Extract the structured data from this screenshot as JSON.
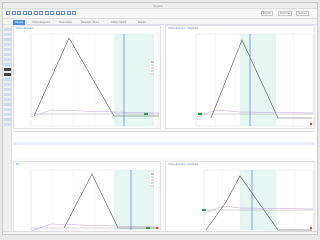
{
  "window": {
    "title": "Skyline"
  },
  "toolbar": {
    "buttons": [
      "new-icon",
      "open-icon",
      "save-icon",
      "undo-icon",
      "redo-icon",
      "cut-icon",
      "copy-icon",
      "paste-icon",
      "zoom-in-icon",
      "zoom-out-icon",
      "select-icon",
      "chart-icon",
      "table-icon"
    ],
    "right_fields": [
      "Peptide",
      "Replicate",
      "Settings"
    ]
  },
  "tabs": [
    {
      "label": "Targets",
      "active": true
    },
    {
      "label": "Chromatograms",
      "active": false
    },
    {
      "label": "Peak Areas",
      "active": false
    },
    {
      "label": "Retention Times",
      "active": false
    },
    {
      "label": "Library Match",
      "active": false
    },
    {
      "label": "Results",
      "active": false
    }
  ],
  "panels": {
    "top_left": {
      "title": "Chromatogram"
    },
    "top_right": {
      "title": "Chromatogram - Replicate"
    },
    "bottom_left": {
      "title": "RT"
    },
    "bottom_right": {
      "title": "Chromatogram - Replicate"
    }
  },
  "table": {
    "rows": [
      [
        "",
        "",
        "",
        "",
        "",
        ""
      ],
      [
        "",
        "",
        "",
        "",
        "",
        ""
      ],
      [
        "",
        "",
        "",
        "",
        "",
        ""
      ],
      [
        "",
        "",
        "",
        "",
        "",
        ""
      ],
      [
        "",
        "",
        "",
        "",
        "",
        ""
      ],
      [
        "",
        "",
        "",
        "",
        "",
        ""
      ]
    ]
  },
  "colors": {
    "accent": "#4a90e2",
    "band": "#d6f0ea",
    "peak": "#555555",
    "marker_green": "#2e9e4a",
    "marker_red": "#d84a4a",
    "cursor": "#3b6fd6"
  }
}
